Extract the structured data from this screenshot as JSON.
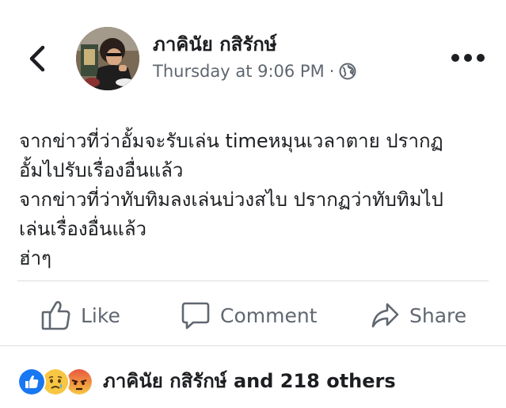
{
  "post": {
    "author": "ภาคินัย กสิรักษ์",
    "timestamp": "Thursday at 9:06 PM",
    "separator": "·",
    "privacy_icon": "globe-icon",
    "content_lines": [
      "จากข่าวที่ว่าอั้มจะรับเล่น timeหมุนเวลาตาย ปรากฏ",
      "อั้มไปรับเรื่องอื่นแล้ว",
      "จากข่าวที่ว่าทับทิมลงเล่นบ่วงสไบ ปรากฏว่าทับทิมไป",
      "เล่นเรื่องอื่นแล้ว",
      "ฮ่าๆ"
    ]
  },
  "actions": {
    "like_label": "Like",
    "comment_label": "Comment",
    "share_label": "Share"
  },
  "reactions": {
    "summary": "ภาคินัย กสิรักษ์ and 218 others",
    "icons": [
      "like-reaction-icon",
      "sad-reaction-icon",
      "angry-reaction-icon"
    ]
  },
  "colors": {
    "text": "#1c1e21",
    "secondary": "#606770",
    "like_blue": "#1877f2",
    "reaction_yellow": "#f7c744",
    "angry_red": "#e9573f"
  }
}
